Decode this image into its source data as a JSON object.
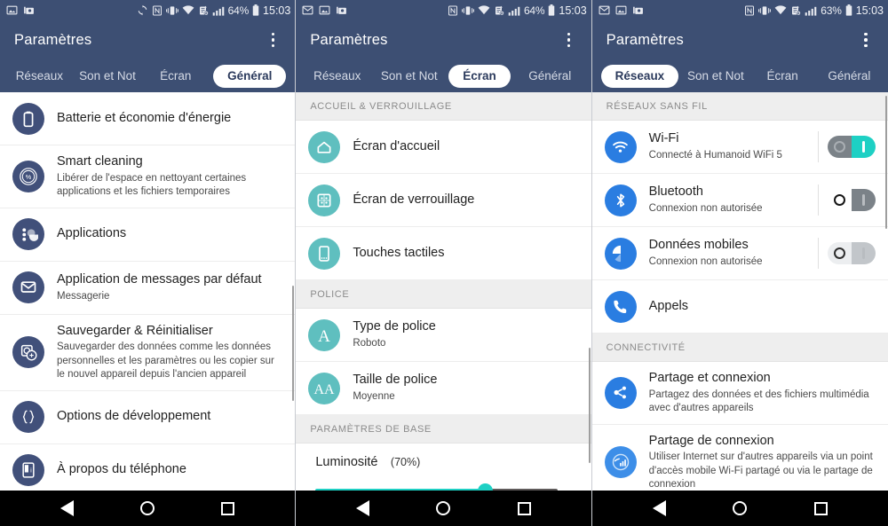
{
  "device": {
    "app_title": "Paramètres",
    "nav": {
      "back": "back-triangle",
      "home": "home-circle",
      "recents": "recents-square"
    }
  },
  "panels": [
    {
      "id": "general",
      "statusbar": {
        "left_icons": [
          "image-icon",
          "screenshot-icon"
        ],
        "right_icons": [
          "sync-icon",
          "nfc-icon",
          "vibrate-icon",
          "wifi-icon",
          "alarm-off-icon",
          "signal-icon"
        ],
        "battery": "64%",
        "time": "15:03"
      },
      "tabs": [
        {
          "label": "Réseaux",
          "active": false
        },
        {
          "label": "Son et Not",
          "active": false,
          "clipped": true
        },
        {
          "label": "Écran",
          "active": false
        },
        {
          "label": "Général",
          "active": true
        }
      ],
      "sections": [
        {
          "header": null,
          "rows": [
            {
              "icon": "battery-icon",
              "icon_color": "navy",
              "title": "Batterie et économie d'énergie",
              "subtitle": null
            },
            {
              "icon": "percent-icon",
              "icon_color": "navy",
              "title": "Smart cleaning",
              "subtitle": "Libérer de l'espace en nettoyant certaines applications et les fichiers temporaires"
            },
            {
              "icon": "apps-icon",
              "icon_color": "navy",
              "title": "Applications",
              "subtitle": null
            },
            {
              "icon": "message-icon",
              "icon_color": "navy",
              "title": "Application de messages par défaut",
              "subtitle": "Messagerie"
            },
            {
              "icon": "backup-restore-icon",
              "icon_color": "navy",
              "title": "Sauvegarder & Réinitialiser",
              "subtitle": "Sauvegarder des données comme les données personnelles et les paramètres ou les copier sur le nouvel appareil depuis l'ancien appareil"
            },
            {
              "icon": "braces-icon",
              "icon_color": "navy",
              "title": "Options de développement",
              "subtitle": null
            },
            {
              "icon": "phone-info-icon",
              "icon_color": "navy",
              "title": "À propos du téléphone",
              "subtitle": null
            }
          ]
        }
      ]
    },
    {
      "id": "ecran",
      "statusbar": {
        "left_icons": [
          "mail-icon",
          "image-icon",
          "screenshot-icon"
        ],
        "right_icons": [
          "nfc-icon",
          "vibrate-icon",
          "wifi-icon",
          "alarm-off-icon",
          "signal-icon"
        ],
        "battery": "64%",
        "time": "15:03"
      },
      "tabs": [
        {
          "label": "Réseaux",
          "active": false
        },
        {
          "label": "Son et Not",
          "active": false,
          "clipped": true
        },
        {
          "label": "Écran",
          "active": true
        },
        {
          "label": "Général",
          "active": false
        }
      ],
      "sections": [
        {
          "header": "ACCUEIL & VERROUILLAGE",
          "rows": [
            {
              "icon": "home-icon",
              "icon_color": "teal",
              "title": "Écran d'accueil",
              "subtitle": null
            },
            {
              "icon": "lockscreen-icon",
              "icon_color": "teal",
              "title": "Écran de verrouillage",
              "subtitle": null
            },
            {
              "icon": "touch-keys-icon",
              "icon_color": "teal",
              "title": "Touches tactiles",
              "subtitle": null
            }
          ]
        },
        {
          "header": "POLICE",
          "rows": [
            {
              "icon": "font-type-icon",
              "icon_color": "teal",
              "icon_glyph": "A",
              "title": "Type de police",
              "subtitle": "Roboto"
            },
            {
              "icon": "font-size-icon",
              "icon_color": "teal",
              "icon_glyph": "AA",
              "title": "Taille de police",
              "subtitle": "Moyenne"
            }
          ]
        },
        {
          "header": "PARAMÈTRES DE BASE",
          "slider": {
            "label": "Luminosité",
            "value_label": "(70%)",
            "value": 70
          }
        }
      ]
    },
    {
      "id": "reseaux",
      "statusbar": {
        "left_icons": [
          "mail-icon",
          "image-icon",
          "screenshot-icon"
        ],
        "right_icons": [
          "nfc-icon",
          "vibrate-icon",
          "wifi-icon",
          "alarm-off-icon",
          "signal-icon"
        ],
        "battery": "63%",
        "time": "15:03"
      },
      "tabs": [
        {
          "label": "Réseaux",
          "active": true
        },
        {
          "label": "Son et Not",
          "active": false,
          "clipped": true
        },
        {
          "label": "Écran",
          "active": false
        },
        {
          "label": "Général",
          "active": false
        }
      ],
      "sections": [
        {
          "header": "RÉSEAUX SANS FIL",
          "rows": [
            {
              "icon": "wifi-icon",
              "icon_color": "blue",
              "title": "Wi-Fi",
              "subtitle": "Connecté à Humanoid WiFi 5",
              "toggle": "on"
            },
            {
              "icon": "bluetooth-icon",
              "icon_color": "blue",
              "title": "Bluetooth",
              "subtitle": "Connexion non autorisée",
              "toggle": "off"
            },
            {
              "icon": "data-usage-icon",
              "icon_color": "blue",
              "title": "Données mobiles",
              "subtitle": "Connexion non autorisée",
              "toggle": "disabled"
            },
            {
              "icon": "phone-call-icon",
              "icon_color": "blue",
              "title": "Appels",
              "subtitle": null
            }
          ]
        },
        {
          "header": "CONNECTIVITÉ",
          "rows": [
            {
              "icon": "share-icon",
              "icon_color": "blue",
              "title": "Partage et connexion",
              "subtitle": "Partagez des données et des fichiers multimédia avec d'autres appareils"
            },
            {
              "icon": "hotspot-icon",
              "icon_color": "blue",
              "title": "Partage de connexion",
              "subtitle": "Utiliser Internet sur d'autres appareils via un point d'accès mobile Wi-Fi partagé ou via le partage de connexion"
            }
          ]
        }
      ]
    }
  ],
  "colors": {
    "appbar": "#3d4f73",
    "accent_teal": "#1ed0c4",
    "accent_blue": "#2a7de1",
    "icon_navy": "#41507a",
    "icon_teal": "#5fbfbf",
    "section_bg": "#eeeeee"
  }
}
